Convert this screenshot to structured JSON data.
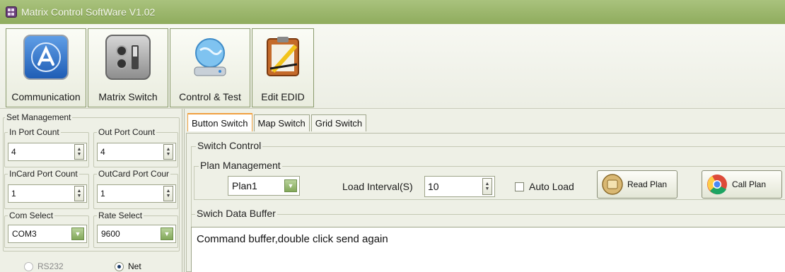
{
  "window": {
    "title": "Matrix Control SoftWare V1.02"
  },
  "toolbar": {
    "buttons": [
      {
        "label": "Communication",
        "icon": "app-store-icon"
      },
      {
        "label": "Matrix Switch",
        "icon": "switch-panel-icon"
      },
      {
        "label": "Control & Test",
        "icon": "globe-drive-icon"
      },
      {
        "label": "Edit EDID",
        "icon": "clipboard-pencil-icon"
      }
    ]
  },
  "set_management": {
    "title": "Set Management",
    "in_port": {
      "label": "In Port Count",
      "value": "4"
    },
    "out_port": {
      "label": "Out Port Count",
      "value": "4"
    },
    "in_card": {
      "label": "InCard Port Count",
      "value": "1"
    },
    "out_card": {
      "label": "OutCard Port Cour",
      "value": "1"
    },
    "com_select": {
      "label": "Com Select",
      "value": "COM3"
    },
    "rate_select": {
      "label": "Rate Select",
      "value": "9600"
    },
    "mode": {
      "rs232_label": "RS232",
      "net_label": "Net",
      "selected": "Net"
    }
  },
  "tabs": [
    {
      "label": "Button Switch",
      "active": true
    },
    {
      "label": "Map Switch",
      "active": false
    },
    {
      "label": "Grid Switch",
      "active": false
    }
  ],
  "switch_control": {
    "title": "Switch Control",
    "plan_management": {
      "title": "Plan Management",
      "plan_value": "Plan1",
      "load_interval_label": "Load Interval(S)",
      "load_interval_value": "10",
      "auto_load_label": "Auto Load",
      "auto_load_checked": false,
      "read_plan_label": "Read Plan",
      "call_plan_label": "Call Plan"
    },
    "buffer": {
      "title": "Swich Data Buffer",
      "text": "Command buffer,double click send again"
    }
  },
  "colors": {
    "titlebar": "#9bb56b",
    "accent_tab": "#f0a040",
    "combo_button": "#8fb066"
  }
}
